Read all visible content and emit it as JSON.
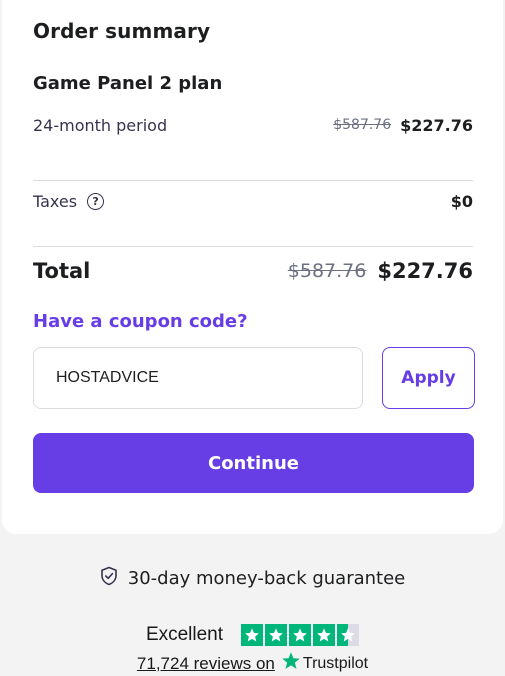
{
  "summary": {
    "title": "Order summary",
    "plan_name": "Game Panel 2 plan",
    "period_label": "24-month period",
    "period_old_price": "$587.76",
    "period_new_price": "$227.76",
    "taxes_label": "Taxes",
    "taxes_help_icon": "question-circle-icon",
    "taxes_value": "$0",
    "total_label": "Total",
    "total_old_price": "$587.76",
    "total_new_price": "$227.76"
  },
  "coupon": {
    "link_label": "Have a coupon code?",
    "input_value": "HOSTADVICE",
    "apply_label": "Apply"
  },
  "actions": {
    "continue_label": "Continue"
  },
  "guarantee": {
    "icon": "shield-check-icon",
    "text": "30-day money-back guarantee"
  },
  "trustpilot": {
    "rating_text": "Excellent",
    "stars_rating": 4.5,
    "reviews_link": "71,724 reviews on",
    "brand": "Trustpilot"
  },
  "colors": {
    "accent": "#673de6",
    "trustpilot_green": "#00b67a",
    "background": "#f3f3f3"
  }
}
